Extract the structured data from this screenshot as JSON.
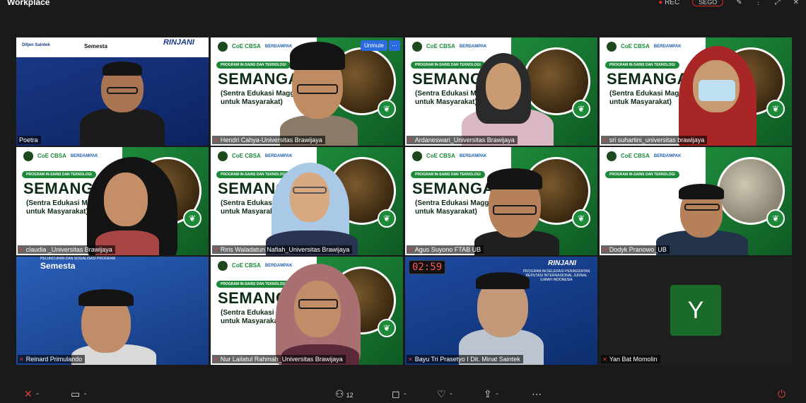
{
  "app": {
    "title": "Workplace"
  },
  "toolbar": {
    "rec_label": "REC",
    "user_label": "SEGO"
  },
  "tiles": [
    {
      "name": "Poetra",
      "active": true,
      "poster": "rinjani"
    },
    {
      "name": "Hendri Cahya-Universitas Brawijaya",
      "poster": "semangat",
      "unmute": "Unmute"
    },
    {
      "name": "Ardaneswari_Universitas Brawijaya",
      "poster": "semangat"
    },
    {
      "name": "sri suhartini_universitas brawijaya",
      "poster": "semangat"
    },
    {
      "name": "claudia _Universitas Brawijaya",
      "poster": "semangat"
    },
    {
      "name": "Riris Waladatun Nafiah_Universitas Brawijaya",
      "poster": "semangat"
    },
    {
      "name": "Agus Suyono FTAB UB",
      "poster": "semangat"
    },
    {
      "name": "Dodyk Pranowo_UB",
      "poster": "semangat"
    },
    {
      "name": "Reinard Primulando",
      "poster": "semesta"
    },
    {
      "name": "Nur Lailatul Rahmah_Universitas Brawijaya",
      "poster": "semangat"
    },
    {
      "name": "Bayu Tri Prasetyo I Dit. Minat Saintek",
      "poster": "rinjani2",
      "timer": "02:59"
    },
    {
      "name": "Yan Bat Momolin",
      "avatar": "Y"
    }
  ],
  "poster": {
    "coe": "CoE CBSA",
    "berdampak": "BERDAMPAK",
    "program": "PROGRAM IN-SAINS DAN TEKNOLOGI",
    "big": "SEMANGAT",
    "sub1": "(Sentra Edukasi Maggot",
    "sub2": "untuk Masyarakat)",
    "semesta": "Semesta",
    "rinjani": "RINJANI",
    "peluncuran": "PELUNCURAN DAN SOSIALISASI PROGRAM",
    "rinjani_sub": "PROGRAM AKSELERASI PENINGKATAN REPUTASI INTERNASIONAL JURNAL ILMIAH INDONESIA"
  },
  "bottombar": {
    "participants_count": "12"
  }
}
